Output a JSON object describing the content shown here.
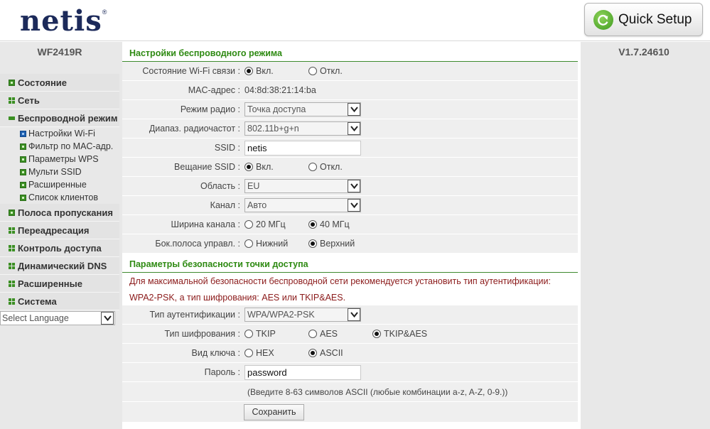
{
  "header": {
    "logo_text": "netis",
    "logo_mark": "®",
    "quick_setup_label": "Quick Setup",
    "quick_setup_icon": "refresh-arrow-icon"
  },
  "device": {
    "model": "WF2419R",
    "firmware": "V1.7.24610"
  },
  "sidebar": {
    "items": [
      {
        "label": "Состояние",
        "icon": "plus-square"
      },
      {
        "label": "Сеть",
        "icon": "grid"
      },
      {
        "label": "Беспроводной режим",
        "icon": "minus"
      },
      {
        "label": "Полоса пропускания",
        "icon": "plus-square"
      },
      {
        "label": "Переадресация",
        "icon": "grid"
      },
      {
        "label": "Контроль доступа",
        "icon": "grid"
      },
      {
        "label": "Динамический DNS",
        "icon": "grid"
      },
      {
        "label": "Расширенные",
        "icon": "grid"
      },
      {
        "label": "Система",
        "icon": "grid"
      }
    ],
    "subitems": [
      {
        "label": "Настройки Wi-Fi",
        "active": true
      },
      {
        "label": "Фильтр по MAC-адр."
      },
      {
        "label": "Параметры WPS"
      },
      {
        "label": "Мульти SSID"
      },
      {
        "label": "Расширенные"
      },
      {
        "label": "Список клиентов"
      }
    ],
    "language": "Select Language"
  },
  "wireless": {
    "title": "Настройки беспроводного режима",
    "wifi_state": {
      "label": "Состояние Wi-Fi связи :",
      "on": "Вкл.",
      "off": "Откл.",
      "selected": "on"
    },
    "mac": {
      "label": "MAC-адрес :",
      "value": "04:8d:38:21:14:ba"
    },
    "radio_mode": {
      "label": "Режим радио :",
      "value": "Точка доступа"
    },
    "band": {
      "label": "Диапаз. радиочастот :",
      "value": "802.11b+g+n"
    },
    "ssid": {
      "label": "SSID :",
      "value": "netis"
    },
    "ssid_broadcast": {
      "label": "Вещание SSID :",
      "on": "Вкл.",
      "off": "Откл.",
      "selected": "on"
    },
    "region": {
      "label": "Область :",
      "value": "EU"
    },
    "channel": {
      "label": "Канал :",
      "value": "Авто"
    },
    "width": {
      "label": "Ширина канала :",
      "opt1": "20 МГц",
      "opt2": "40 МГц",
      "selected": "opt2"
    },
    "sideband": {
      "label": "Бок.полоса управл. :",
      "opt1": "Нижний",
      "opt2": "Верхний",
      "selected": "opt2"
    }
  },
  "security": {
    "title": "Параметры безопасности точки доступа",
    "warn1": "Для максимальной безопасности беспроводной сети рекомендуется установить тип аутентификации:",
    "warn2": "WPA2-PSK, а тип шифрования: AES или TKIP&AES.",
    "auth": {
      "label": "Тип аутентификации :",
      "value": "WPA/WPA2-PSK"
    },
    "cipher": {
      "label": "Тип шифрования :",
      "opt1": "TKIP",
      "opt2": "AES",
      "opt3": "TKIP&AES",
      "selected": "opt3"
    },
    "key_type": {
      "label": "Вид ключа :",
      "opt1": "HEX",
      "opt2": "ASCII",
      "selected": "opt2"
    },
    "password": {
      "label": "Пароль :",
      "value": "password"
    },
    "hint": "(Введите 8-63 символов ASCII (любые комбинации a-z, A-Z, 0-9.))",
    "save_label": "Сохранить"
  },
  "colors": {
    "accent_green": "#2e8a12",
    "warning": "#8b1a1a",
    "logo": "#1c2a5a"
  }
}
